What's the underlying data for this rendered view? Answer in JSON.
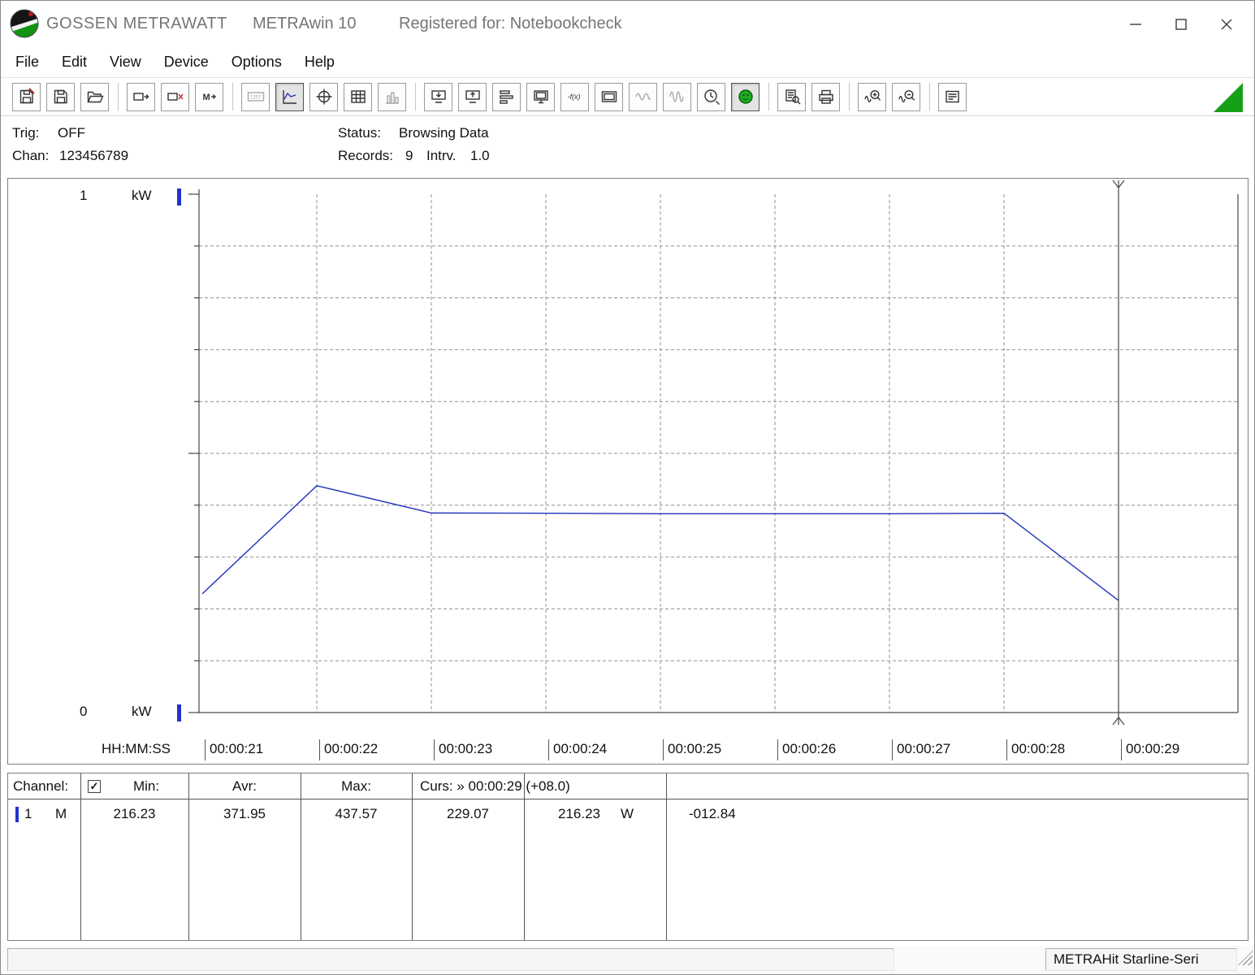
{
  "titlebar": {
    "brand": "GOSSEN METRAWATT",
    "app": "METRAwin 10",
    "registered": "Registered for: Notebookcheck"
  },
  "menu": {
    "items": [
      "File",
      "Edit",
      "View",
      "Device",
      "Options",
      "Help"
    ]
  },
  "toolbar": {
    "icons": [
      "save-annotate",
      "save",
      "open",
      "read-device",
      "clear-device",
      "memory-read",
      "multimeter-display",
      "trend-view",
      "scope-view",
      "table-view",
      "bargraph-view",
      "download",
      "upload",
      "schedule",
      "monitor",
      "formula",
      "device-display",
      "waveform-small",
      "waveform-large",
      "interval-clock",
      "device-online",
      "print-preview",
      "print",
      "zoom-in-wave",
      "zoom-out-wave",
      "annotation",
      "green-corner-triangle"
    ]
  },
  "status_panel": {
    "trig_label": "Trig:",
    "trig_value": "OFF",
    "chan_label": "Chan:",
    "chan_value": "123456789",
    "status_label": "Status:",
    "status_value": "Browsing Data",
    "records_label": "Records:",
    "records_value": "9",
    "intrv_label": "Intrv.",
    "intrv_value": "1.0"
  },
  "chart_data": {
    "type": "line",
    "title": "",
    "x_axis_label": "HH:MM:SS",
    "x_ticks": [
      "00:00:21",
      "00:00:22",
      "00:00:23",
      "00:00:24",
      "00:00:25",
      "00:00:26",
      "00:00:27",
      "00:00:28",
      "00:00:29"
    ],
    "y_axis": {
      "top_label": "1",
      "bottom_label": "0",
      "unit": "kW",
      "min": 0,
      "max": 1000
    },
    "grid": "dashed",
    "legend": "none",
    "series": [
      {
        "name": "channel-1-power-W",
        "color": "#2233bb",
        "values": [
          229.07,
          437.57,
          385,
          384.5,
          383.5,
          383.5,
          383.5,
          384.5,
          216.23
        ]
      }
    ],
    "cursor": {
      "x_index": 8,
      "time": "00:00:29"
    }
  },
  "results_table": {
    "header": {
      "channel": "Channel:",
      "min": "Min:",
      "avr": "Avr:",
      "max": "Max:",
      "curs": "Curs: » 00:00:29 (+08.0)"
    },
    "row": {
      "channel": "1",
      "mode": "M",
      "min": "216.23",
      "avr": "371.95",
      "max": "437.57",
      "cursor_a": "229.07",
      "cursor_b": "216.23",
      "cursor_b_unit": "W",
      "delta": "-012.84"
    }
  },
  "statusbar": {
    "device": "METRAHit Starline-Seri"
  },
  "colors": {
    "series": "#2233bb",
    "accent_green": "#17a017",
    "channel_marker": "#2233cc"
  }
}
